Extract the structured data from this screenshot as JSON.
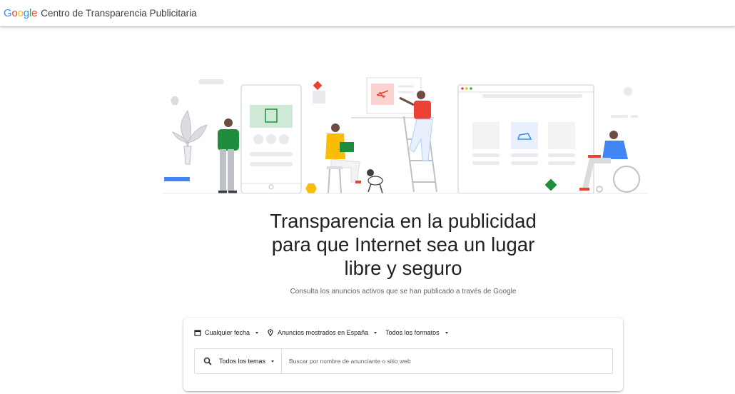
{
  "header": {
    "logo": [
      "G",
      "o",
      "o",
      "g",
      "l",
      "e"
    ],
    "title": "Centro de Transparencia Publicitaria"
  },
  "hero": {
    "headline_lines": [
      "Transparencia en la publicidad",
      "para que Internet sea un lugar",
      "libre y seguro"
    ],
    "subtitle": "Consulta los anuncios activos que se han publicado a través de Google"
  },
  "filters": {
    "date": "Cualquier fecha",
    "location": "Anuncios mostrados en España",
    "format": "Todos los formatos"
  },
  "search": {
    "topics": "Todos los temas",
    "placeholder": "Buscar por nombre de anunciante o sitio web"
  },
  "colors": {
    "blue": "#4285f4",
    "red": "#ea4335",
    "yellow": "#fbbc05",
    "green": "#34a853"
  }
}
